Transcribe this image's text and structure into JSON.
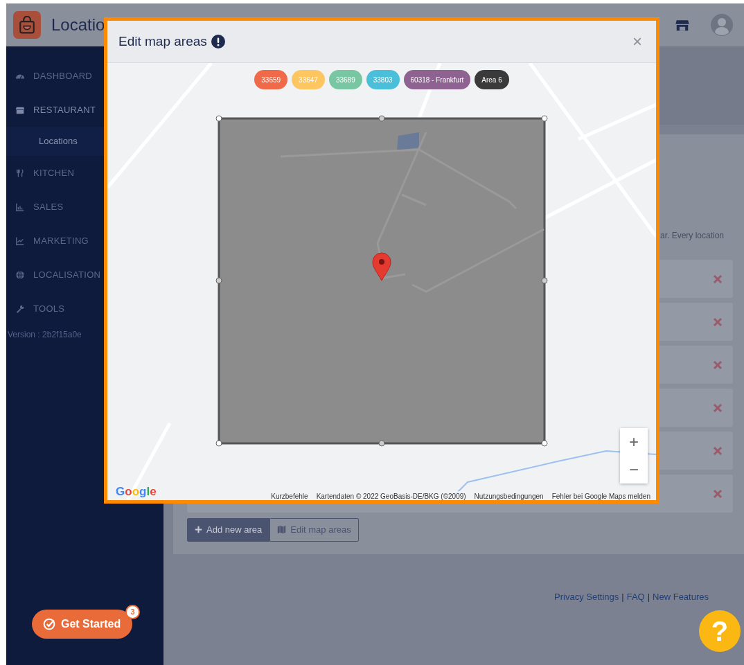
{
  "header": {
    "title": "Locatio"
  },
  "sidebar": {
    "items": [
      {
        "kind": "section",
        "label": "DASHBOARD",
        "selected": false
      },
      {
        "kind": "section",
        "label": "RESTAURANT",
        "selected": true
      },
      {
        "kind": "sub",
        "label": "Locations",
        "selected": true
      },
      {
        "kind": "section",
        "label": "KITCHEN",
        "selected": false
      },
      {
        "kind": "section",
        "label": "SALES",
        "selected": false
      },
      {
        "kind": "section",
        "label": "MARKETING",
        "selected": false
      },
      {
        "kind": "section",
        "label": "LOCALISATION",
        "selected": false
      },
      {
        "kind": "section",
        "label": "TOOLS",
        "selected": false
      }
    ],
    "version": "Version : 2b2f15a0e"
  },
  "content": {
    "description": "ar. Every location",
    "buttons": [
      {
        "label": "Add new area",
        "kind": "primary"
      },
      {
        "label": "Edit map areas",
        "kind": "outline"
      }
    ]
  },
  "footer": {
    "links": [
      "Privacy Settings",
      "FAQ",
      "New Features"
    ],
    "separator": "|"
  },
  "get_started": {
    "label": "Get Started",
    "badge": "3"
  },
  "help": {
    "label": "?"
  },
  "modal": {
    "title": "Edit map areas",
    "close": "×",
    "area_tags": [
      {
        "label": "33659",
        "color": "#f06a4a"
      },
      {
        "label": "33647",
        "color": "#fdc661"
      },
      {
        "label": "33689",
        "color": "#79c6a2"
      },
      {
        "label": "33803",
        "color": "#4bbfd9"
      },
      {
        "label": "60318 - Frankfurt",
        "color": "#8e6291"
      },
      {
        "label": "Area 6",
        "color": "#3a3a3a"
      }
    ],
    "map": {
      "zoom_in": "+",
      "zoom_out": "−",
      "logo": "Google",
      "attribution": [
        "Kurzbefehle",
        "Kartendaten © 2022 GeoBasis-DE/BKG (©2009)",
        "Nutzungsbedingungen",
        "Fehler bei Google Maps melden"
      ]
    }
  }
}
